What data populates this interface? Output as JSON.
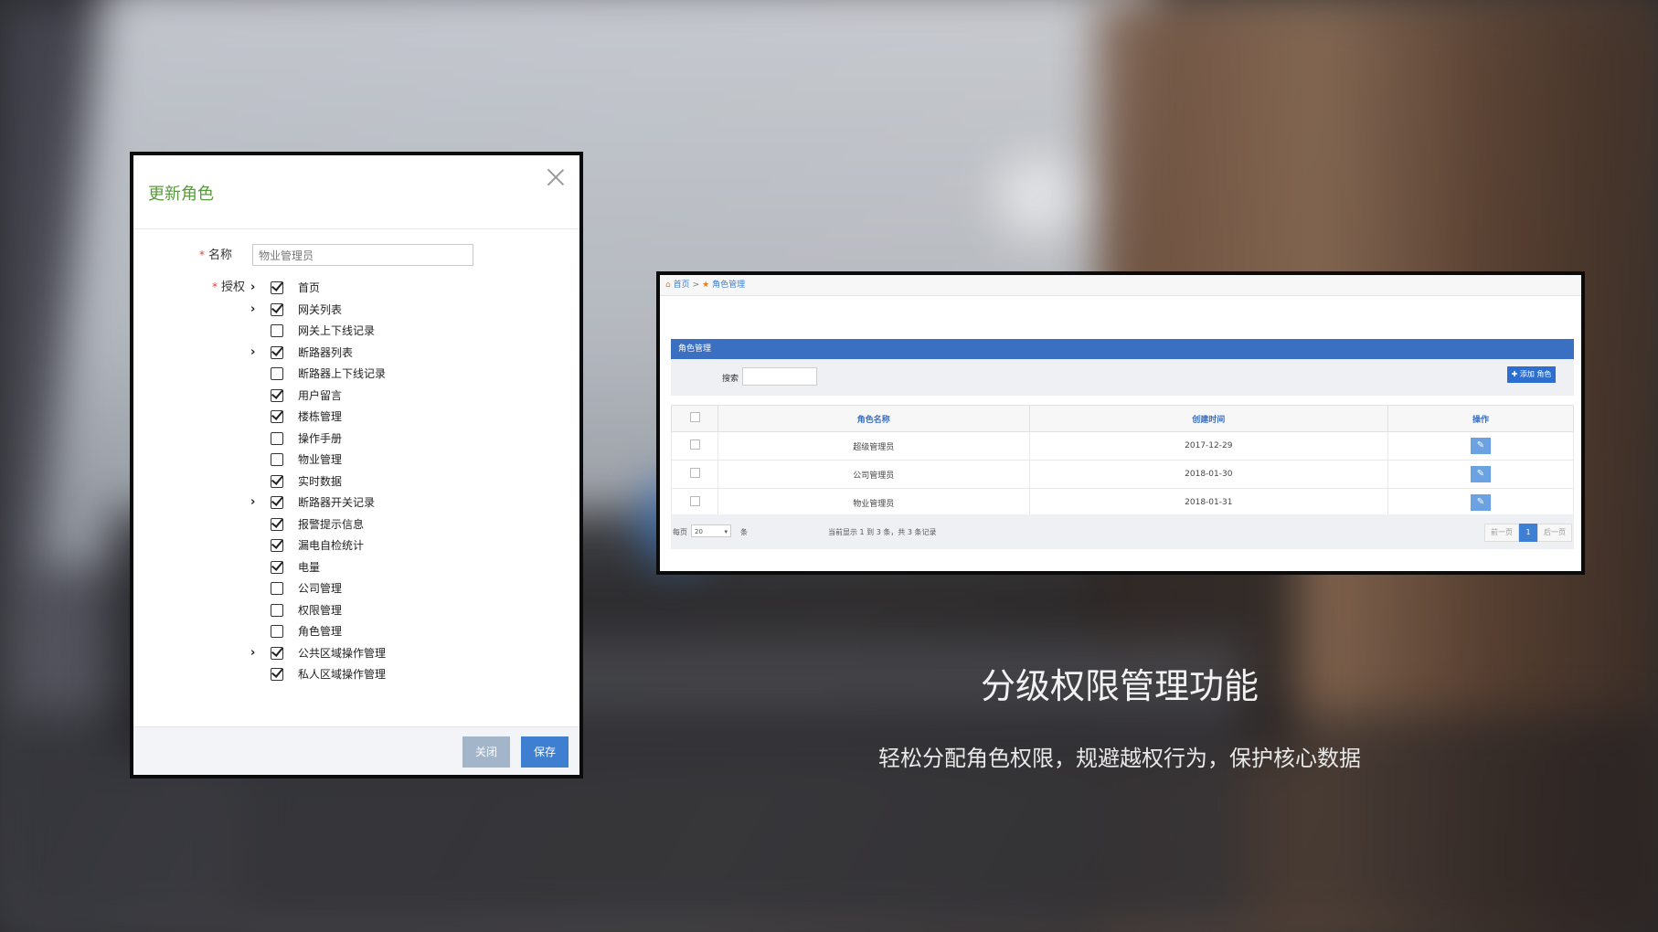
{
  "dialog": {
    "title": "更新角色",
    "name_label": "名称",
    "name_value": "物业管理员",
    "auth_label": "授权",
    "permissions": [
      {
        "label": "首页",
        "checked": true,
        "expandable": true
      },
      {
        "label": "网关列表",
        "checked": true,
        "expandable": true
      },
      {
        "label": "网关上下线记录",
        "checked": false,
        "expandable": false
      },
      {
        "label": "断路器列表",
        "checked": true,
        "expandable": true
      },
      {
        "label": "断路器上下线记录",
        "checked": false,
        "expandable": false
      },
      {
        "label": "用户留言",
        "checked": true,
        "expandable": false
      },
      {
        "label": "楼栋管理",
        "checked": true,
        "expandable": false
      },
      {
        "label": "操作手册",
        "checked": false,
        "expandable": false
      },
      {
        "label": "物业管理",
        "checked": false,
        "expandable": false
      },
      {
        "label": "实时数据",
        "checked": true,
        "expandable": false
      },
      {
        "label": "断路器开关记录",
        "checked": true,
        "expandable": true
      },
      {
        "label": "报警提示信息",
        "checked": true,
        "expandable": false
      },
      {
        "label": "漏电自检统计",
        "checked": true,
        "expandable": false
      },
      {
        "label": "电量",
        "checked": true,
        "expandable": false
      },
      {
        "label": "公司管理",
        "checked": false,
        "expandable": false
      },
      {
        "label": "权限管理",
        "checked": false,
        "expandable": false
      },
      {
        "label": "角色管理",
        "checked": false,
        "expandable": false
      },
      {
        "label": "公共区域操作管理",
        "checked": true,
        "expandable": true
      },
      {
        "label": "私人区域操作管理",
        "checked": true,
        "expandable": false
      }
    ],
    "close_label": "关闭",
    "save_label": "保存"
  },
  "panel": {
    "breadcrumb": {
      "home": "首页",
      "separator": ">",
      "current": "角色管理"
    },
    "box_title": "角色管理",
    "search_label": "搜索",
    "add_button": "✚ 添加 角色",
    "columns": [
      "角色名称",
      "创建时间",
      "操作"
    ],
    "rows": [
      {
        "name": "超级管理员",
        "created": "2017-12-29"
      },
      {
        "name": "公司管理员",
        "created": "2018-01-30"
      },
      {
        "name": "物业管理员",
        "created": "2018-01-31"
      }
    ],
    "pager": {
      "per_page_label": "每页",
      "per_page_value": "20",
      "unit": "条",
      "info": "当前显示 1 到 3 条，共 3 条记录",
      "prev": "前一页",
      "current": "1",
      "next": "后一页"
    }
  },
  "headline": "分级权限管理功能",
  "subline": "轻松分配角色权限，规避越权行为，保护核心数据",
  "colors": {
    "primary_blue": "#3b6fc1",
    "title_green": "#5a9a3e",
    "required_red": "#e0463c"
  }
}
